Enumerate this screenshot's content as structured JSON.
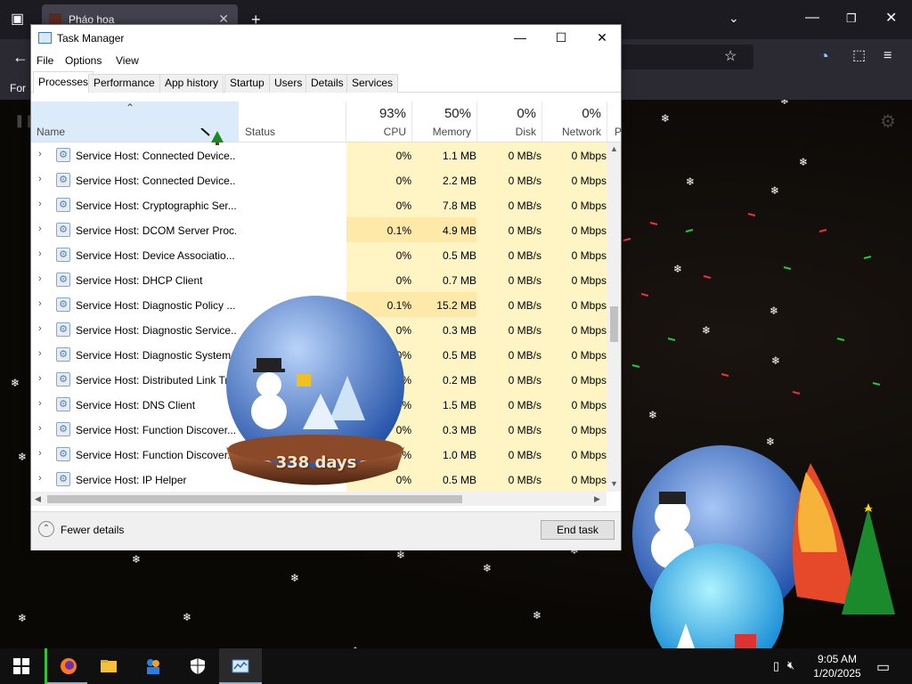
{
  "browser": {
    "tab_title": "Pháo hoa",
    "bookmark_text": "For"
  },
  "window": {
    "title": "Task Manager",
    "menu": [
      "File",
      "Options",
      "View"
    ]
  },
  "tabs": [
    {
      "label": "Processes",
      "active": true
    },
    {
      "label": "Performance"
    },
    {
      "label": "App history"
    },
    {
      "label": "Startup"
    },
    {
      "label": "Users"
    },
    {
      "label": "Details"
    },
    {
      "label": "Services"
    }
  ],
  "columns": {
    "name": "Name",
    "status": "Status",
    "cpu": {
      "label": "CPU",
      "pct": "93%"
    },
    "memory": {
      "label": "Memory",
      "pct": "50%"
    },
    "disk": {
      "label": "Disk",
      "pct": "0%"
    },
    "network": {
      "label": "Network",
      "pct": "0%"
    },
    "power": "P"
  },
  "rows": [
    {
      "name": "Service Host: Connected Device...",
      "cpu": "0%",
      "memory": "1.1 MB",
      "disk": "0 MB/s",
      "network": "0 Mbps"
    },
    {
      "name": "Service Host: Connected Device...",
      "cpu": "0%",
      "memory": "2.2 MB",
      "disk": "0 MB/s",
      "network": "0 Mbps"
    },
    {
      "name": "Service Host: Cryptographic Ser...",
      "cpu": "0%",
      "memory": "7.8 MB",
      "disk": "0 MB/s",
      "network": "0 Mbps"
    },
    {
      "name": "Service Host: DCOM Server Proc...",
      "cpu": "0.1%",
      "memory": "4.9 MB",
      "disk": "0 MB/s",
      "network": "0 Mbps"
    },
    {
      "name": "Service Host: Device Associatio...",
      "cpu": "0%",
      "memory": "0.5 MB",
      "disk": "0 MB/s",
      "network": "0 Mbps"
    },
    {
      "name": "Service Host: DHCP Client",
      "cpu": "0%",
      "memory": "0.7 MB",
      "disk": "0 MB/s",
      "network": "0 Mbps"
    },
    {
      "name": "Service Host: Diagnostic Policy ...",
      "cpu": "0.1%",
      "memory": "15.2 MB",
      "disk": "0 MB/s",
      "network": "0 Mbps"
    },
    {
      "name": "Service Host: Diagnostic Service...",
      "cpu": "0%",
      "memory": "0.3 MB",
      "disk": "0 MB/s",
      "network": "0 Mbps"
    },
    {
      "name": "Service Host: Diagnostic System...",
      "cpu": "0%",
      "memory": "0.5 MB",
      "disk": "0 MB/s",
      "network": "0 Mbps"
    },
    {
      "name": "Service Host: Distributed Link Tr...",
      "cpu": "0%",
      "memory": "0.2 MB",
      "disk": "0 MB/s",
      "network": "0 Mbps"
    },
    {
      "name": "Service Host: DNS Client",
      "cpu": "0%",
      "memory": "1.5 MB",
      "disk": "0 MB/s",
      "network": "0 Mbps"
    },
    {
      "name": "Service Host: Function Discover...",
      "cpu": "0%",
      "memory": "0.3 MB",
      "disk": "0 MB/s",
      "network": "0 Mbps"
    },
    {
      "name": "Service Host: Function Discover...",
      "cpu": "0%",
      "memory": "1.0 MB",
      "disk": "0 MB/s",
      "network": "0 Mbps"
    },
    {
      "name": "Service Host: IP Helper",
      "cpu": "0%",
      "memory": "0.5 MB",
      "disk": "0 MB/s",
      "network": "0 Mbps"
    }
  ],
  "footer": {
    "fewer_details": "Fewer details",
    "end_task": "End task"
  },
  "globe": {
    "countdown": "338 days"
  },
  "clock": {
    "time": "9:05 AM",
    "date": "1/20/2025"
  }
}
